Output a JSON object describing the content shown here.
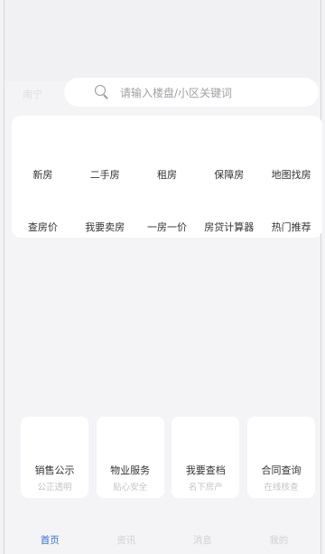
{
  "header": {
    "city": "南宁"
  },
  "search": {
    "placeholder": "请输入楼盘/小区关键词"
  },
  "menu": {
    "row1": [
      "新房",
      "二手房",
      "租房",
      "保障房",
      "地图找房"
    ],
    "row2": [
      "查房价",
      "我要卖房",
      "一房一价",
      "房贷计算器",
      "热门推荐"
    ]
  },
  "cards": [
    {
      "title": "销售公示",
      "subtitle": "公正透明"
    },
    {
      "title": "物业服务",
      "subtitle": "贴心安全"
    },
    {
      "title": "我要查档",
      "subtitle": "名下房产"
    },
    {
      "title": "合同查询",
      "subtitle": "在线核查"
    }
  ],
  "tabbar": {
    "active_color": "#2f6fd6",
    "tabs": [
      "首页",
      "资讯",
      "消息",
      "我的"
    ],
    "active_index": 0
  }
}
